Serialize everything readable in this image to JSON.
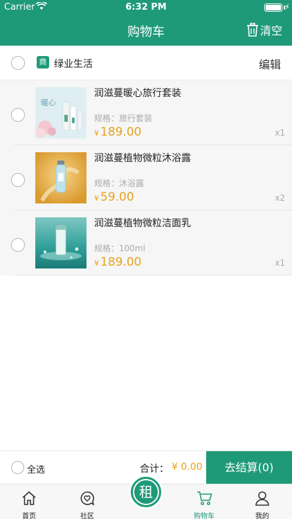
{
  "status_bar": {
    "carrier": "Carrier",
    "time": "6:32 PM"
  },
  "header": {
    "title": "购物车",
    "clear_label": "清空"
  },
  "store": {
    "badge": "商",
    "name": "绿业生活",
    "edit_label": "编辑"
  },
  "items": [
    {
      "name": "润滋蔓暖心旅行套装",
      "spec": "规格：旅行套装",
      "currency": "¥",
      "price": "189.00",
      "qty": "x1"
    },
    {
      "name": "润滋蔓植物微粒沐浴露",
      "spec": "规格：沐浴露",
      "currency": "¥",
      "price": "59.00",
      "qty": "x2"
    },
    {
      "name": "润滋蔓植物微粒洁面乳",
      "spec": "规格：100ml",
      "currency": "¥",
      "price": "189.00",
      "qty": "x1"
    }
  ],
  "thumb_text": {
    "item1": "暖心"
  },
  "bottom_bar": {
    "select_all": "全选",
    "total_label": "合计：",
    "total_value": "¥ 0.00",
    "checkout_label": "去结算(0)"
  },
  "tabbar": {
    "tabs": [
      {
        "label": "首页",
        "icon": "home-icon"
      },
      {
        "label": "社区",
        "icon": "community-icon"
      },
      {
        "label": "购物车",
        "icon": "cart-icon",
        "active": true
      },
      {
        "label": "我的",
        "icon": "user-icon"
      }
    ],
    "center_glyph": "租"
  },
  "colors": {
    "brand": "#1f9a78",
    "price": "#e8a21c"
  }
}
